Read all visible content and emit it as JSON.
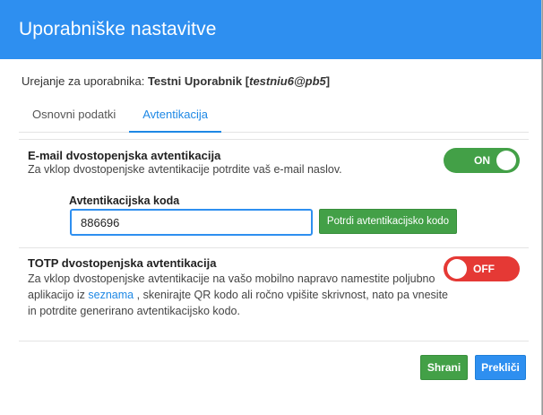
{
  "header": {
    "title": "Uporabniške nastavitve"
  },
  "user_line": {
    "prefix": "Urejanje za uporabnika:",
    "name": "Testni Uporabnik",
    "login": "testniu6@pb5"
  },
  "tabs": [
    {
      "label": "Osnovni podatki",
      "active": false
    },
    {
      "label": "Avtentikacija",
      "active": true
    }
  ],
  "email_2fa": {
    "title": "E-mail dvostopenjska avtentikacija",
    "description": "Za vklop dvostopenjske avtentikacije potrdite vaš e-mail naslov.",
    "toggle_label": "ON",
    "code_label": "Avtentikacijska koda",
    "code_value": "886696",
    "confirm_label": "Potrdi avtentikacijsko kodo"
  },
  "totp_2fa": {
    "title": "TOTP dvostopenjska avtentikacija",
    "desc_line1": "Za vklop dvostopenjske avtentikacije na vašo mobilno napravo namestite poljubno",
    "desc_line2_pre": "aplikacijo iz",
    "desc_link": "seznama",
    "desc_line2_post": ", skenirajte QR kodo ali ročno vpišite skrivnost, nato pa vnesite",
    "desc_line3": "in potrdite generirano avtentikacijsko kodo.",
    "toggle_label": "OFF"
  },
  "footer": {
    "save_label": "Shrani",
    "cancel_label": "Prekliči"
  },
  "colors": {
    "primary": "#2e8ff0",
    "success": "#43a047",
    "danger": "#e53935"
  }
}
